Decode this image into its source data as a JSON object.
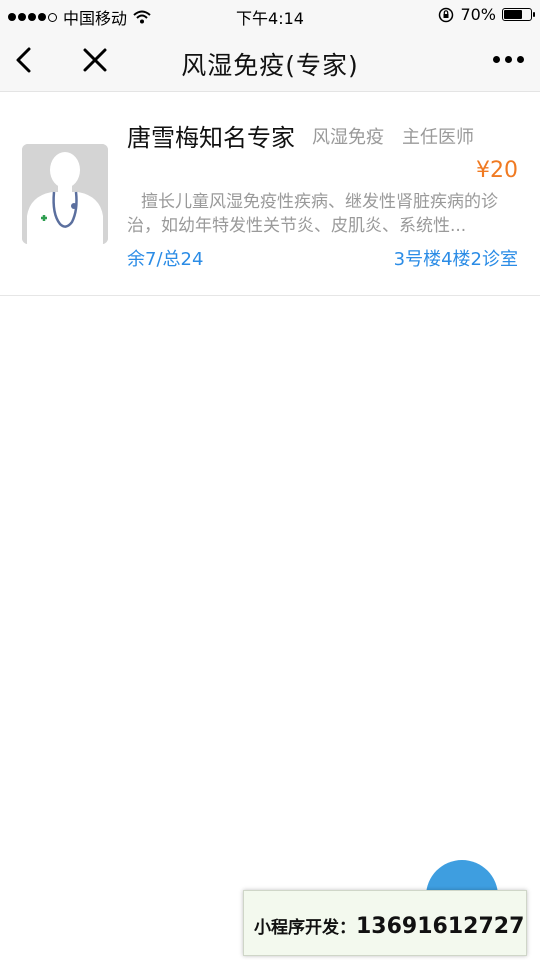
{
  "status_bar": {
    "carrier": "中国移动",
    "time": "下午4:14",
    "battery_text": "70%",
    "battery_level": 0.7,
    "signal_icon": "signal-dots-icon",
    "wifi_icon": "wifi-icon",
    "rotation_lock_icon": "rotation-lock-icon"
  },
  "nav": {
    "title": "风湿免疫(专家)",
    "back_icon": "chevron-left-icon",
    "close_icon": "close-icon",
    "more_icon": "more-dots-icon"
  },
  "doctor": {
    "name": "唐雪梅知名专家",
    "department": "风湿免疫",
    "title": "主任医师",
    "price": "¥20",
    "description": "擅长儿童风湿免疫性疾病、继发性肾脏疾病的诊治，如幼年特发性关节炎、皮肌炎、系统性...",
    "quota": "余7/总24",
    "location": "3号楼4楼2诊室",
    "avatar_icon": "doctor-avatar-icon"
  },
  "promo": {
    "label": "小程序开发：",
    "phone": "13691612727"
  },
  "colors": {
    "price": "#f07a22",
    "link": "#2b8ce6",
    "fab": "#3e9ee0",
    "muted": "#9a9a9a"
  }
}
